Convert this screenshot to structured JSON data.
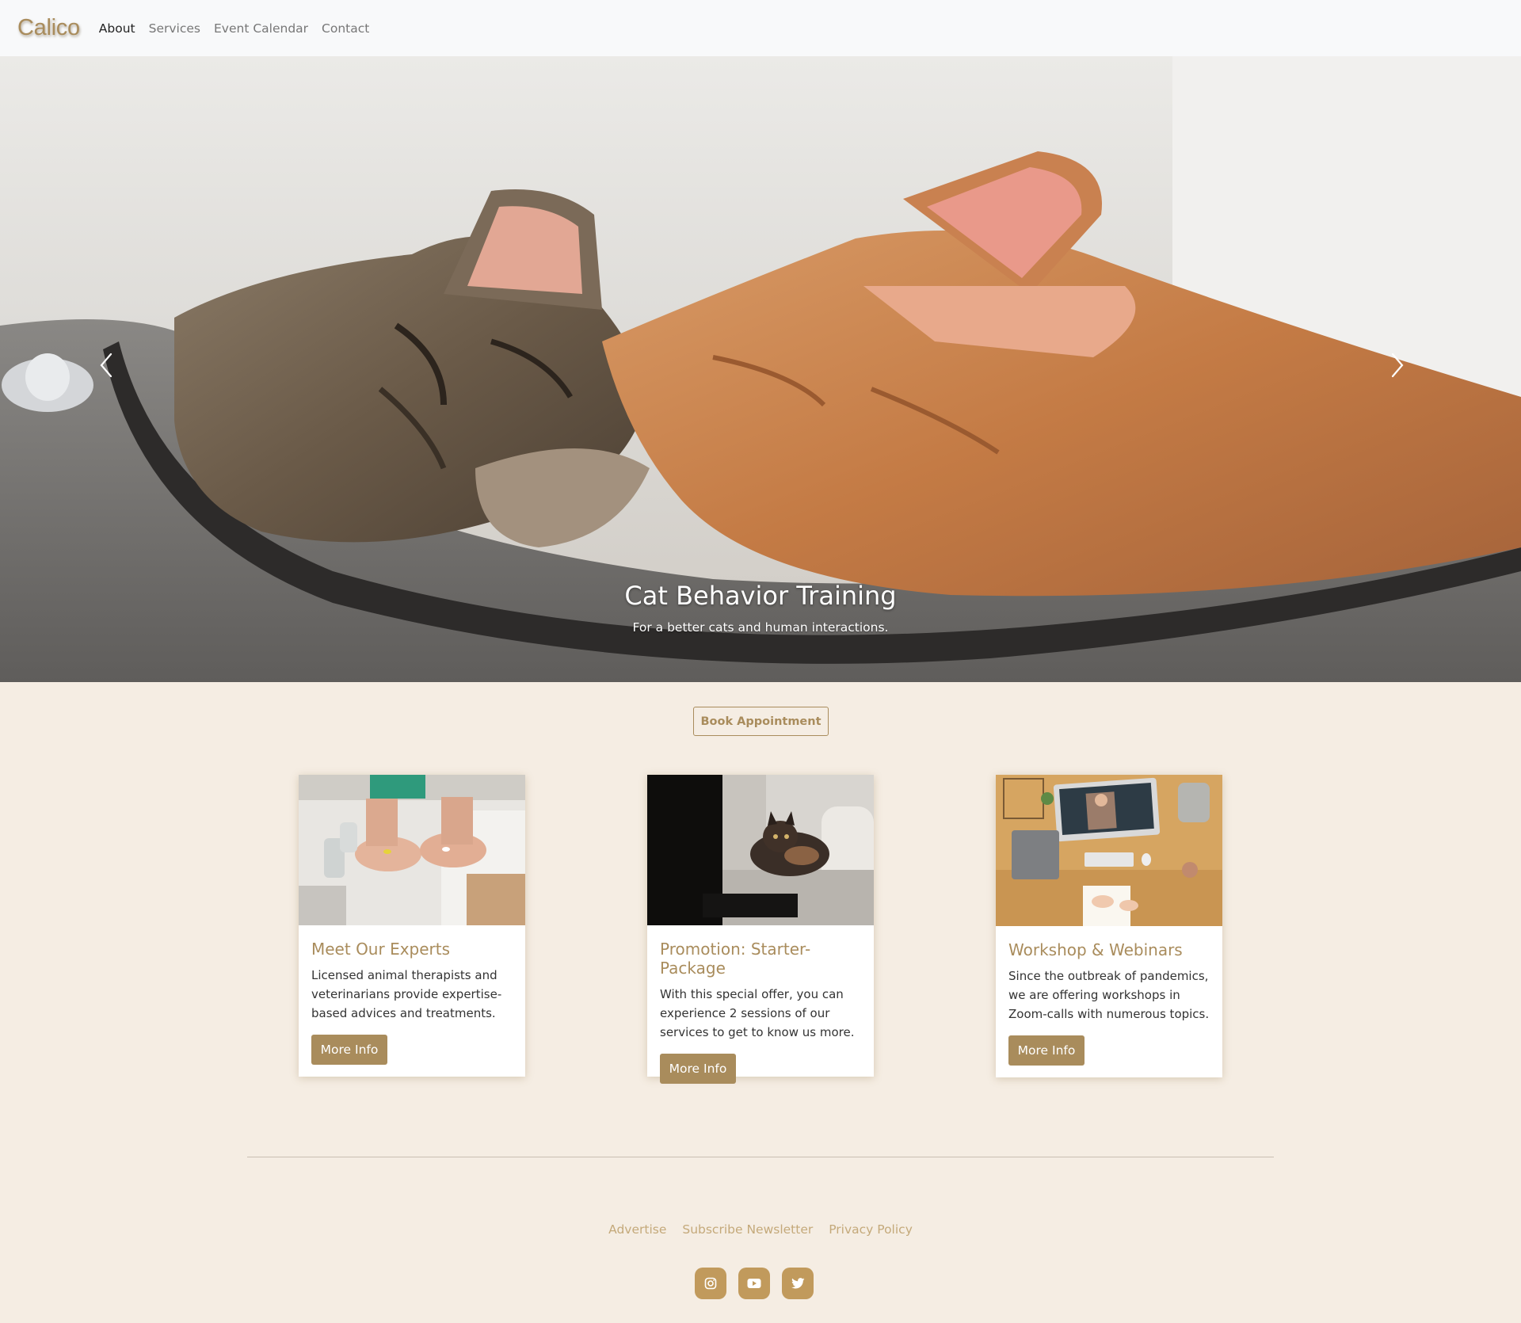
{
  "nav": {
    "brand": "Calico",
    "links": [
      "About",
      "Services",
      "Event Calendar",
      "Contact"
    ]
  },
  "hero": {
    "title": "Cat Behavior Training",
    "subtitle": "For a better cats and human interactions.",
    "prev_icon": "chevron-left-icon",
    "next_icon": "chevron-right-icon"
  },
  "book_button": "Book Appointment",
  "cards": [
    {
      "title": "Meet Our Experts",
      "text": "Licensed animal therapists and veterinarians provide expertise-based advices and treatments.",
      "button": "More Info"
    },
    {
      "title": "Promotion: Starter-Package",
      "text": "With this special offer, you can experience 2 sessions of our services to get to know us more.",
      "button": "More Info"
    },
    {
      "title": "Workshop & Webinars",
      "text": "Since the outbreak of pandemics, we are offering workshops in Zoom-calls with numerous topics.",
      "button": "More Info"
    }
  ],
  "footer": {
    "links": [
      "Advertise",
      "Subscribe Newsletter",
      "Privacy Policy"
    ],
    "socials": [
      "instagram-icon",
      "youtube-icon",
      "twitter-icon"
    ]
  },
  "colors": {
    "accent": "#a98c5c",
    "background": "#f5ede3",
    "social": "#c19a5c"
  }
}
